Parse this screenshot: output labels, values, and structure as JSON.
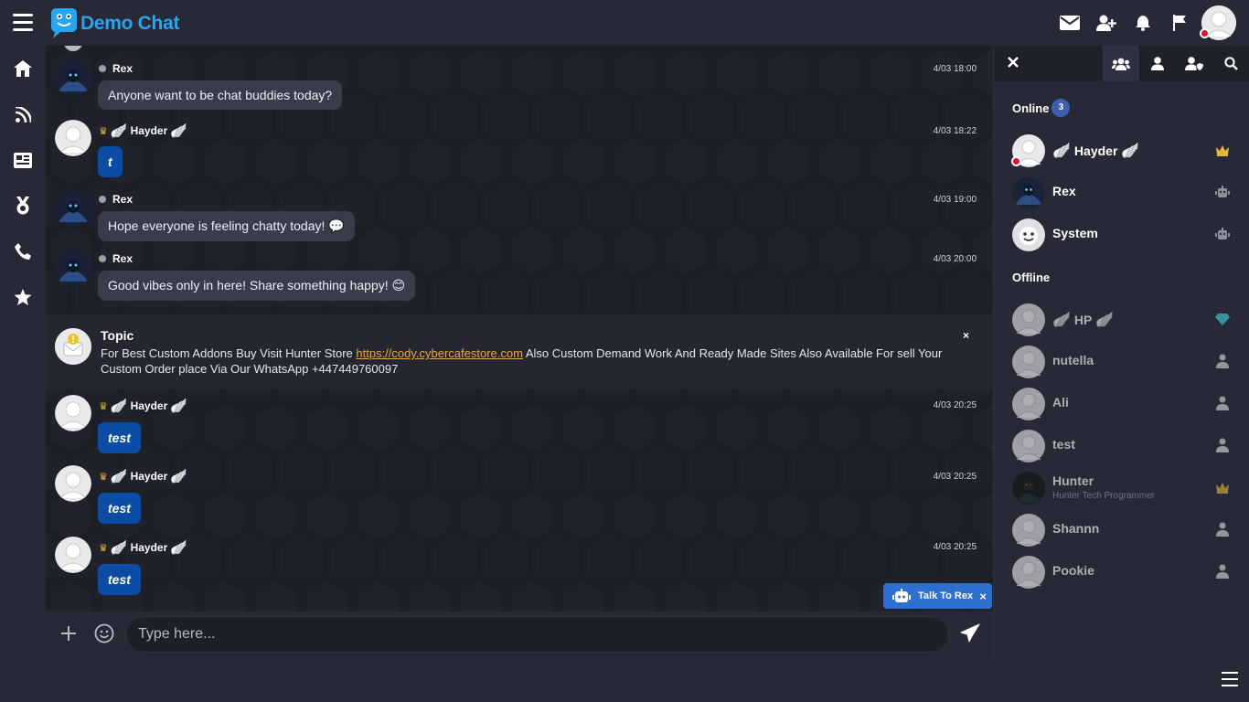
{
  "app": {
    "brand": "Demo Chat"
  },
  "topbar": {
    "icons": [
      "envelope-icon",
      "add-friend-icon",
      "bell-icon",
      "flag-icon"
    ]
  },
  "leftrail": [
    "home-icon",
    "rss-feed-icon",
    "news-icon",
    "medal-icon",
    "phone-icon",
    "star-icon"
  ],
  "messages": [
    {
      "user": "Rex",
      "time": "4/03 18:00",
      "text": "Anyone want to be chat buddies today?",
      "style": "normal"
    },
    {
      "user": "Hayder",
      "time": "4/03 18:22",
      "text": "t",
      "style": "blue"
    },
    {
      "user": "Rex",
      "time": "4/03 19:00",
      "text": "Hope everyone is feeling chatty today! 💬",
      "style": "normal"
    },
    {
      "user": "Rex",
      "time": "4/03 20:00",
      "text": "Good vibes only in here! Share something happy! 😊",
      "style": "normal"
    },
    {
      "user": "Hayder",
      "time": "4/03 20:25",
      "text": "test",
      "style": "blue"
    },
    {
      "user": "Hayder",
      "time": "4/03 20:25",
      "text": "test",
      "style": "blue"
    },
    {
      "user": "Hayder",
      "time": "4/03 20:25",
      "text": "test",
      "style": "blue"
    }
  ],
  "topic": {
    "title": "Topic",
    "text_before": "For Best Custom Addons Buy Visit Hunter Store ",
    "link": "https://cody.cybercafestore.com",
    "text_after": " Also Custom Demand Work And Ready Made Sites Also Available For sell Your Custom Order place Via Our WhatsApp +447449760097",
    "close": "×"
  },
  "talk_rex": {
    "label": "Talk To Rex",
    "close": "×"
  },
  "input": {
    "placeholder": "Type here..."
  },
  "rpanel": {
    "online_title": "Online",
    "online_count": "3",
    "offline_title": "Offline",
    "online": [
      {
        "name": "Hayder",
        "role": "crown-icon"
      },
      {
        "name": "Rex",
        "role": "robot-icon"
      },
      {
        "name": "System",
        "role": "robot-icon"
      }
    ],
    "offline": [
      {
        "name": "HP",
        "role": "diamond-icon"
      },
      {
        "name": "nutella",
        "role": "user-icon"
      },
      {
        "name": "Ali",
        "role": "user-icon"
      },
      {
        "name": "test",
        "role": "user-icon"
      },
      {
        "name": "Hunter",
        "sub": "Hunter Tech Programmer",
        "role": "crown-icon"
      },
      {
        "name": "Shannn",
        "role": "user-icon"
      },
      {
        "name": "Pookie",
        "role": "user-icon"
      }
    ]
  },
  "colors": {
    "accent": "#26a6f2",
    "bubble_blue": "#0b4da6",
    "link": "#f0a73c",
    "badge": "#3c5fb0"
  }
}
